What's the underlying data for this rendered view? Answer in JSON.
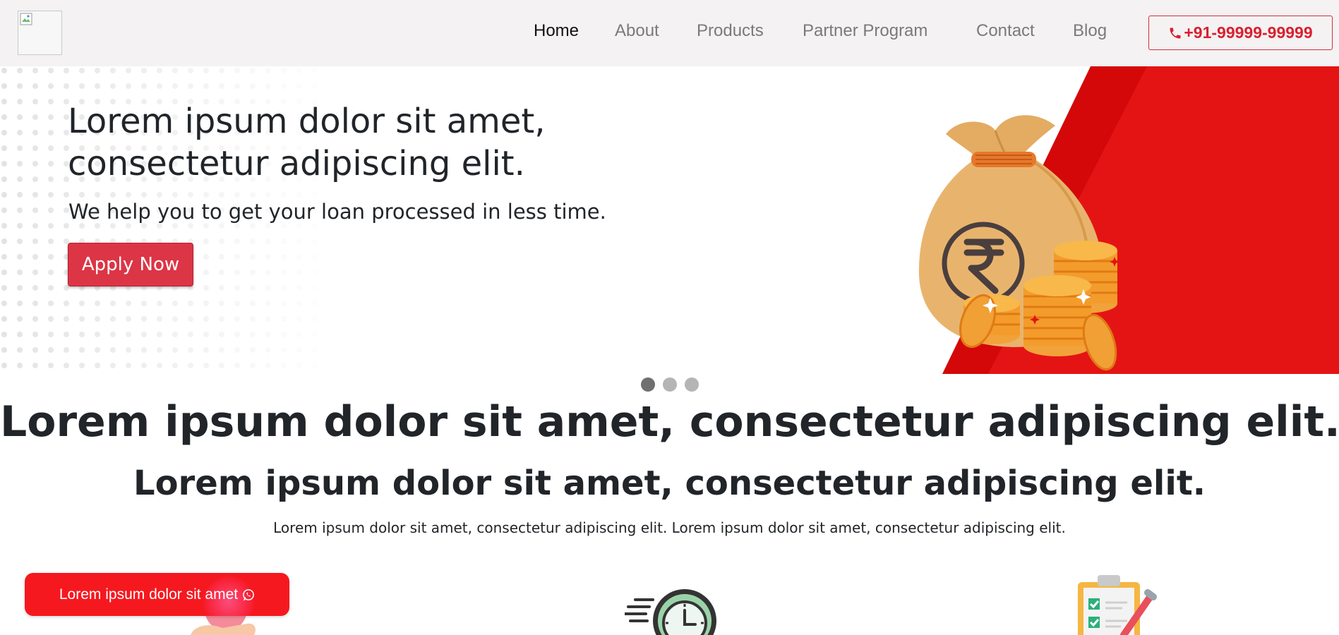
{
  "nav": {
    "items": [
      {
        "label": "Home",
        "active": true
      },
      {
        "label": "About",
        "active": false
      },
      {
        "label": "Products",
        "active": false
      },
      {
        "label": "Partner Program",
        "active": false
      },
      {
        "label": "Contact",
        "active": false
      },
      {
        "label": "Blog",
        "active": false
      }
    ],
    "phone": "+91-99999-99999",
    "phone_icon": "phone-icon"
  },
  "hero": {
    "title": "Lorem ipsum dolor sit amet, consectetur adipiscing elit.",
    "subtitle": "We help you to get your loan processed in less time.",
    "cta": "Apply Now",
    "illustration": "money-bag-rupee-coins",
    "slides": 3,
    "active_slide": 1
  },
  "section": {
    "heading": "Lorem ipsum dolor sit amet, consectetur adipiscing elit.",
    "subheading": "Lorem ipsum dolor sit amet, consectetur adipiscing elit.",
    "text": "Lorem ipsum dolor sit amet, consectetur adipiscing elit. Lorem ipsum dolor sit amet, consectetur adipiscing elit.",
    "features": [
      {
        "icon": "hand-coin-icon"
      },
      {
        "icon": "fast-clock-icon"
      },
      {
        "icon": "clipboard-checklist-icon"
      }
    ]
  },
  "whatsapp": {
    "label": "Lorem ipsum dolor sit amet",
    "icon": "whatsapp-icon"
  },
  "colors": {
    "brand_red": "#dc3545",
    "hero_red": "#e01010",
    "nav_bg": "#f4f2f2"
  }
}
